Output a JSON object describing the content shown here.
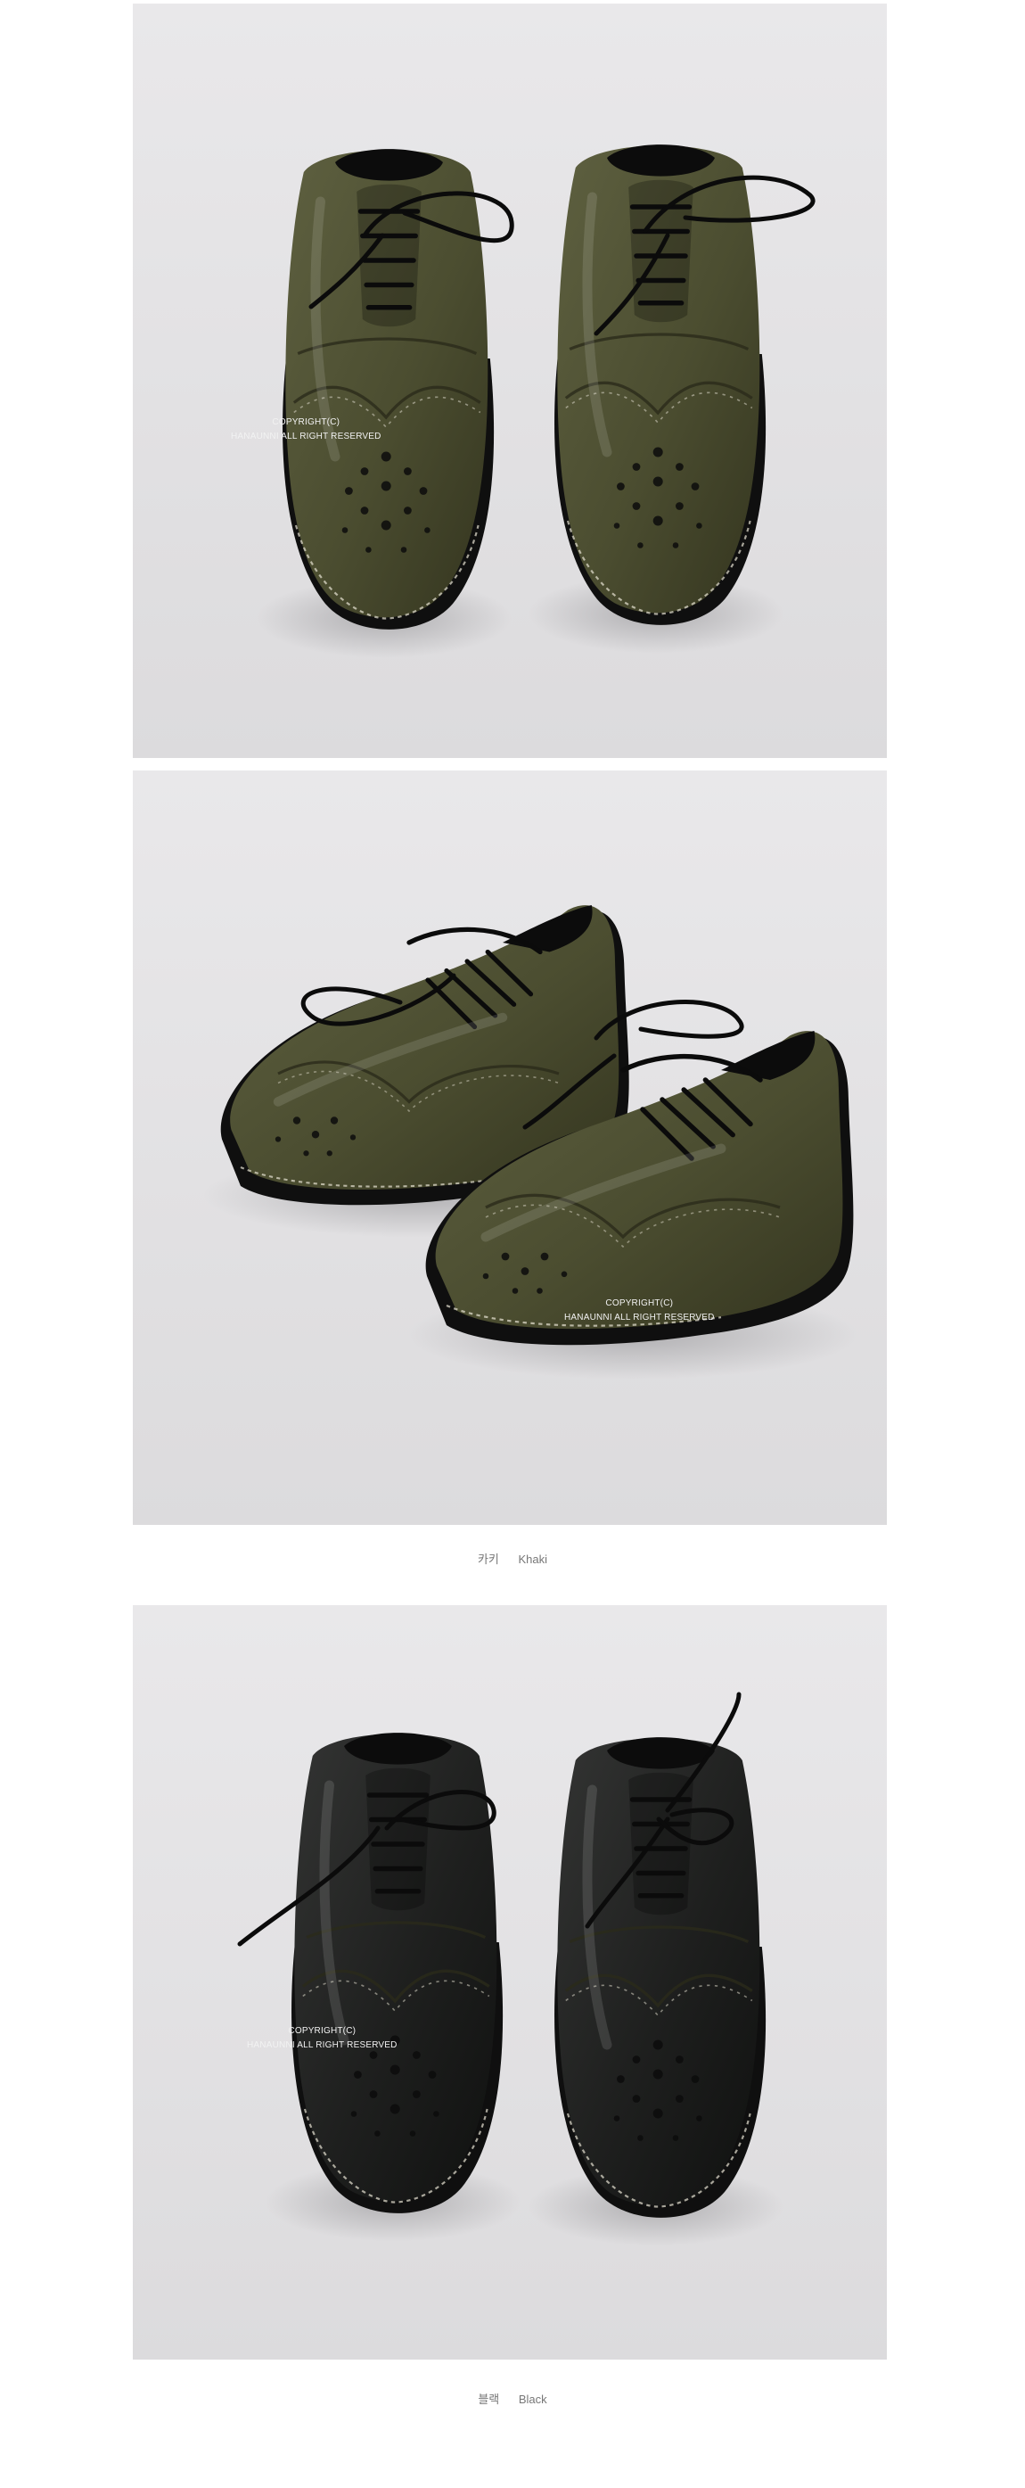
{
  "colors": {
    "background": "#ffffff",
    "photo_backdrop": "#e5e4e6",
    "khaki_leather": "#4b4d30",
    "black_leather": "#1e1f1e",
    "caption_text": "#777777"
  },
  "photos": [
    {
      "subject": "Khaki brogue oxford pair, front view",
      "watermark": {
        "line1": "COPYRIGHT(C)",
        "line2": "HANAUNNI ALL RIGHT RESERVED"
      }
    },
    {
      "subject": "Khaki brogue oxford pair, angled view",
      "watermark": {
        "line1": "COPYRIGHT(C)",
        "line2": "HANAUNNI ALL RIGHT RESERVED"
      }
    },
    {
      "subject": "Black brogue oxford pair, front view",
      "watermark": {
        "line1": "COPYRIGHT(C)",
        "line2": "HANAUNNI ALL RIGHT RESERVED"
      }
    }
  ],
  "captions": {
    "khaki": {
      "korean": "카키",
      "english": "Khaki"
    },
    "black": {
      "korean": "블랙",
      "english": "Black"
    }
  }
}
